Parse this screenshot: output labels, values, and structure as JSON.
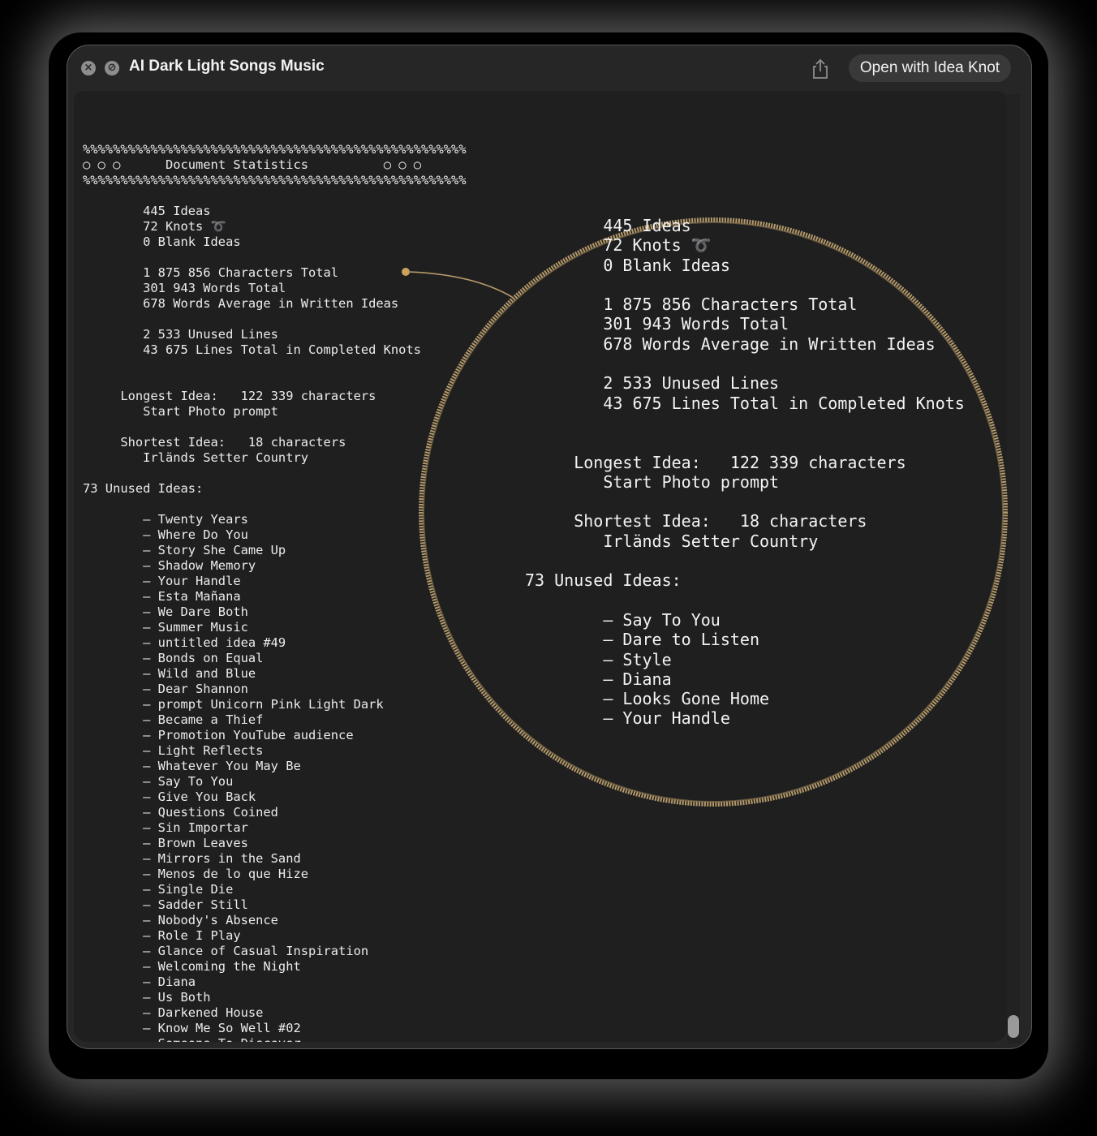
{
  "window": {
    "title": "AI Dark Light Songs Music",
    "open_button": "Open with Idea Knot",
    "close_icon": "×",
    "secondary_icon": "⊘",
    "share_icon_name": "share-icon"
  },
  "document": {
    "rule": "%%%%%%%%%%%%%%%%%%%%%%%%%%%%%%%%%%%%%%%%%%%%%%%%%%%",
    "header_dots": "○ ○ ○",
    "header_title": "Document Statistics",
    "stats": [
      "445 Ideas",
      "72 Knots",
      "0 Blank Ideas",
      "1 875 856 Characters Total",
      "301 943 Words Total",
      "678 Words Average in Written Ideas",
      "2 533 Unused Lines",
      "43 675 Lines Total in Completed Knots"
    ],
    "knot_glyph": "➰",
    "longest_label": "Longest Idea:",
    "longest_value": "122 339 characters",
    "longest_name": "Start Photo prompt",
    "shortest_label": "Shortest Idea:",
    "shortest_value": "18 characters",
    "shortest_name": "Irländs Setter Country",
    "unused_heading": "73 Unused Ideas:",
    "unused_ideas": [
      "Twenty Years",
      "Where Do You",
      "Story She Came Up",
      "Shadow Memory",
      "Your Handle",
      "Esta Mañana",
      "We Dare Both",
      "Summer Music",
      "untitled idea #49",
      "Bonds on Equal",
      "Wild and Blue",
      "Dear Shannon",
      "prompt Unicorn Pink Light Dark",
      "Became a Thief",
      "Promotion YouTube audience",
      "Light Reflects",
      "Whatever You May Be",
      "Say To You",
      "Give You Back",
      "Questions Coined",
      "Sin Importar",
      "Brown Leaves",
      "Mirrors in the Sand",
      "Menos de lo que Hize",
      "Single Die",
      "Sadder Still",
      "Nobody's Absence",
      "Role I Play",
      "Glance of Casual Inspiration",
      "Welcoming the Night",
      "Diana",
      "Us Both",
      "Darkened House",
      "Know Me So Well #02",
      "Someone To Discover"
    ]
  },
  "zoom": {
    "unused_ideas": [
      "Say To You",
      "Dare to Listen",
      "Style",
      "Diana",
      "Looks Gone Home",
      "Your Handle"
    ],
    "accent_color": "#b59a6b"
  }
}
